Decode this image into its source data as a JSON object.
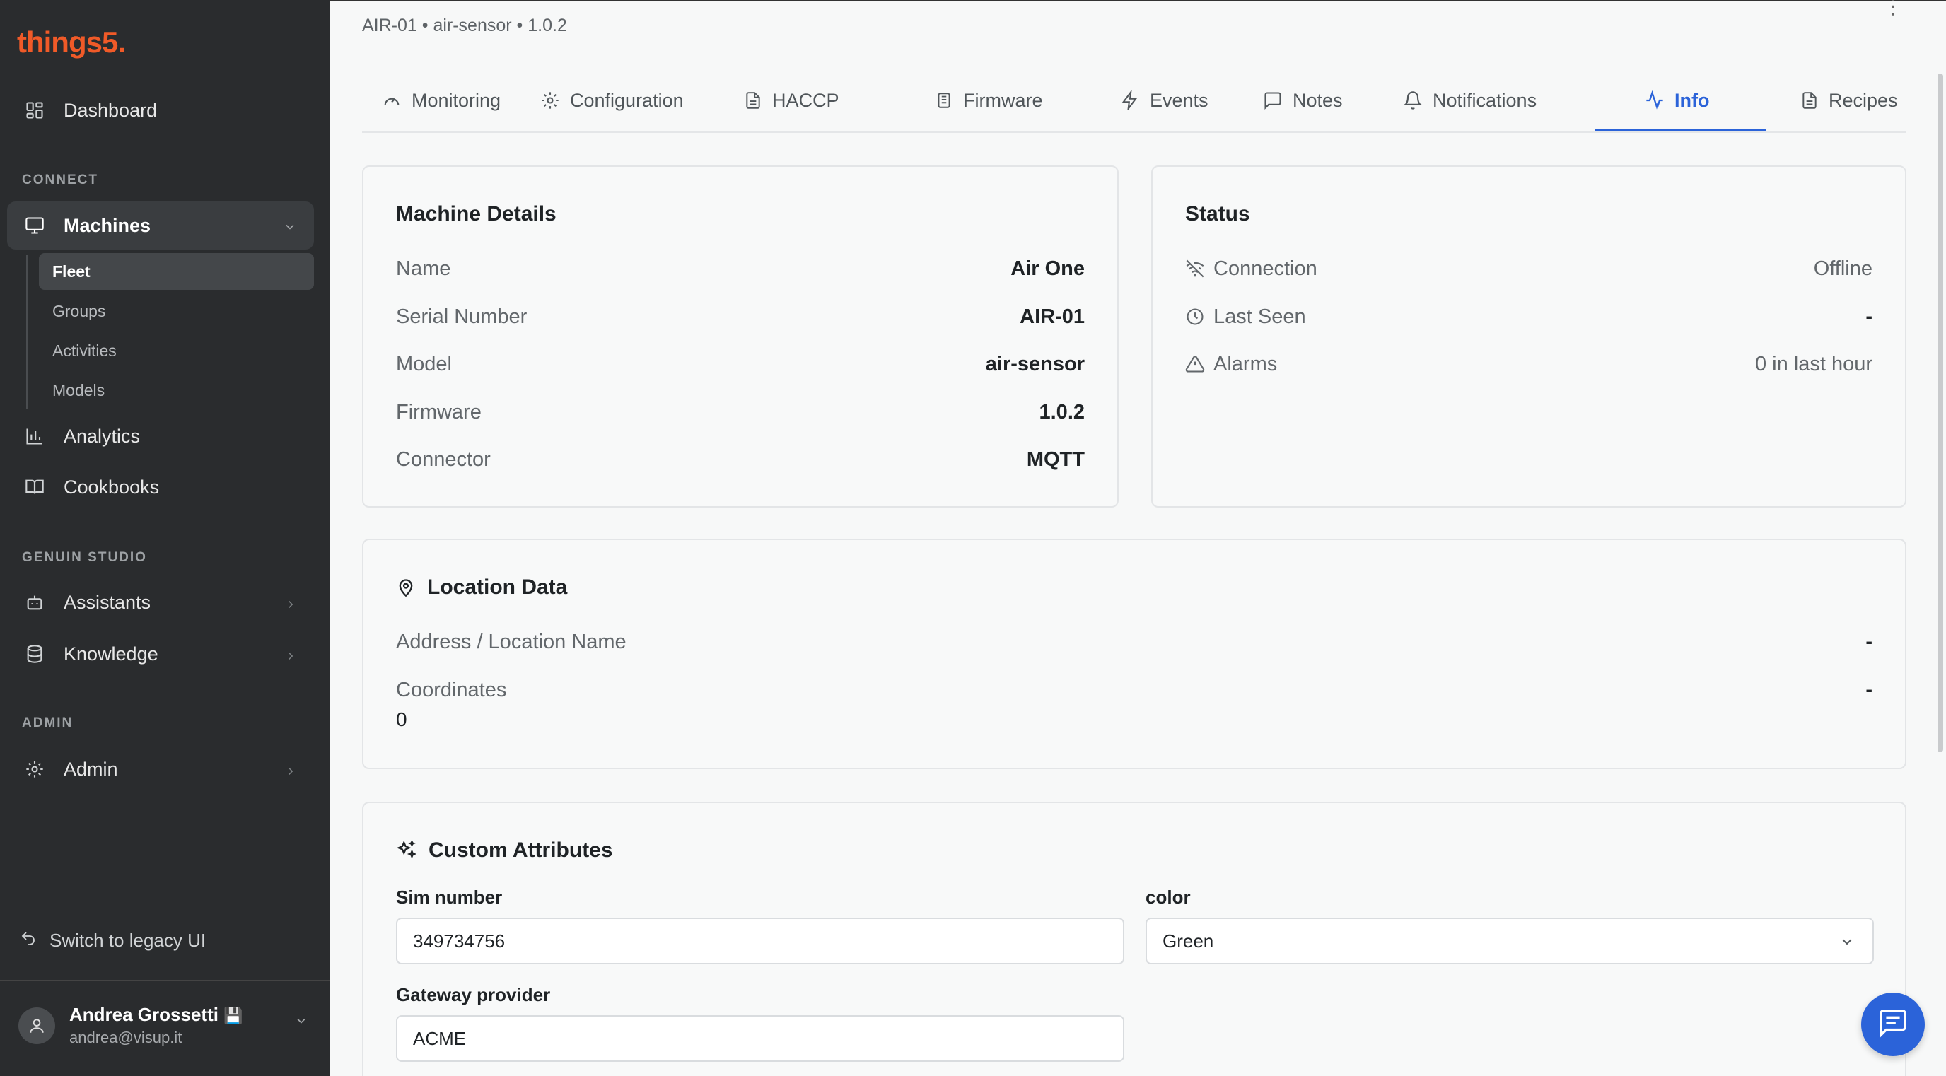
{
  "app": {
    "logo": "things5."
  },
  "sidebar": {
    "dashboard": "Dashboard",
    "connect_label": "CONNECT",
    "machines": "Machines",
    "machines_sub": [
      "Fleet",
      "Groups",
      "Activities",
      "Models"
    ],
    "analytics": "Analytics",
    "cookbooks": "Cookbooks",
    "genuin_label": "GENUIN STUDIO",
    "assistants": "Assistants",
    "knowledge": "Knowledge",
    "admin_label": "ADMIN",
    "admin": "Admin",
    "legacy": "Switch to legacy UI",
    "user_name": "Andrea Grossetti",
    "user_badge": "💾",
    "user_email": "andrea@visup.it"
  },
  "header": {
    "breadcrumb": "AIR-01 • air-sensor • 1.0.2",
    "kebab": "⋮"
  },
  "tabs": [
    "Monitoring",
    "Configuration",
    "HACCP",
    "Firmware",
    "Events",
    "Notes",
    "Notifications",
    "Info",
    "Recipes"
  ],
  "machine_details": {
    "title": "Machine Details",
    "rows": [
      {
        "k": "Name",
        "v": "Air One"
      },
      {
        "k": "Serial Number",
        "v": "AIR-01"
      },
      {
        "k": "Model",
        "v": "air-sensor"
      },
      {
        "k": "Firmware",
        "v": "1.0.2"
      },
      {
        "k": "Connector",
        "v": "MQTT"
      }
    ]
  },
  "status": {
    "title": "Status",
    "rows": [
      {
        "k": "Connection",
        "v": "Offline",
        "icon": "wifi-off-icon"
      },
      {
        "k": "Last Seen",
        "v": "-",
        "icon": "clock-icon"
      },
      {
        "k": "Alarms",
        "v": "0 in last hour",
        "icon": "alert-triangle-icon"
      }
    ]
  },
  "location": {
    "title": "Location Data",
    "address_label": "Address / Location Name",
    "address_value": "-",
    "coords_label": "Coordinates",
    "coords_value": "-",
    "coords_extra": "0"
  },
  "custom_attributes": {
    "title": "Custom Attributes",
    "sim_label": "Sim number",
    "sim_value": "349734756",
    "color_label": "color",
    "color_value": "Green",
    "gateway_label": "Gateway provider",
    "gateway_value": "ACME"
  },
  "colors": {
    "accent": "#2b63d9",
    "brand": "#f05a28",
    "sidebar": "#2a2c2e"
  }
}
